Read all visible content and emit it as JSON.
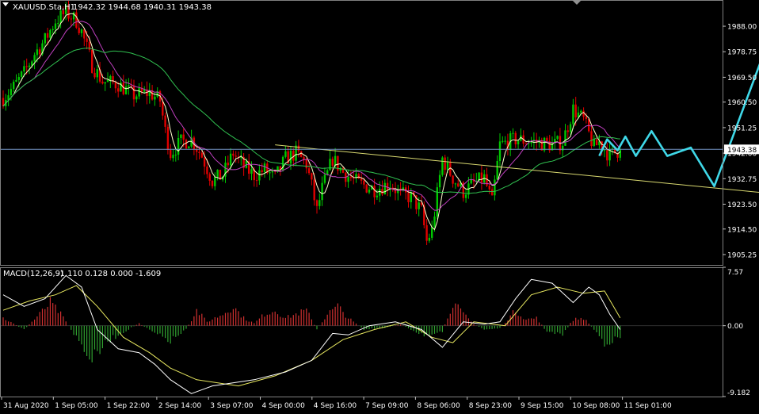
{
  "header": {
    "symbol_title": "XAUUSD.Sta,H1",
    "ohlc": "1942.32 1944.68 1940.31 1943.38"
  },
  "macd": {
    "title": "MACD(12,26,9)",
    "values": "-1.110 0.128 0.000 -1.609"
  },
  "colors": {
    "background": "#000000",
    "bull": "#00C800",
    "bear": "#E00000",
    "ma_fast": "#FFFFCC",
    "ma_mid": "#C040C0",
    "ma_slow": "#30C050",
    "trendline": "#D8D870",
    "forecast": "#3FD8E8",
    "price_line": "#7090C0",
    "macd_main": "#FFFFFF",
    "macd_signal": "#E8E860",
    "macd_hist_pos": "#D03030",
    "macd_hist_neg": "#30A030"
  },
  "chart_data": [
    {
      "type": "candlestick",
      "title": "XAUUSD.Sta,H1",
      "timeframe": "H1",
      "ylim": [
        1901.5,
        1997.5
      ],
      "y_ticks": [
        "1988.00",
        "1978.75",
        "1969.50",
        "1960.50",
        "1951.25",
        "1942.00",
        "1932.75",
        "1923.50",
        "1914.50",
        "1905.25"
      ],
      "current_price": "1943.38",
      "x_tick_labels": [
        "31 Aug 2020",
        "1 Sep 05:00",
        "1 Sep 22:00",
        "2 Sep 14:00",
        "3 Sep 07:00",
        "4 Sep 00:00",
        "4 Sep 16:00",
        "7 Sep 09:00",
        "8 Sep 06:00",
        "8 Sep 23:00",
        "9 Sep 15:00",
        "10 Sep 08:00",
        "11 Sep 01:00"
      ],
      "price_path": [
        [
          0,
          1962
        ],
        [
          4,
          1966
        ],
        [
          8,
          1971
        ],
        [
          12,
          1978
        ],
        [
          16,
          1983
        ],
        [
          20,
          1990
        ],
        [
          24,
          1993
        ],
        [
          28,
          1990
        ],
        [
          30,
          1986
        ],
        [
          34,
          1974
        ],
        [
          38,
          1968
        ],
        [
          44,
          1967
        ],
        [
          50,
          1963
        ],
        [
          56,
          1964
        ],
        [
          60,
          1961
        ],
        [
          62,
          1950
        ],
        [
          64,
          1942
        ],
        [
          68,
          1946
        ],
        [
          72,
          1947
        ],
        [
          76,
          1941
        ],
        [
          80,
          1932
        ],
        [
          84,
          1934
        ],
        [
          88,
          1942
        ],
        [
          92,
          1937
        ],
        [
          96,
          1934
        ],
        [
          100,
          1936
        ],
        [
          104,
          1933
        ],
        [
          108,
          1940
        ],
        [
          112,
          1942
        ],
        [
          116,
          1938
        ],
        [
          118,
          1930
        ],
        [
          120,
          1921
        ],
        [
          122,
          1929
        ],
        [
          126,
          1940
        ],
        [
          130,
          1935
        ],
        [
          136,
          1931
        ],
        [
          142,
          1929
        ],
        [
          148,
          1931
        ],
        [
          152,
          1927
        ],
        [
          156,
          1926
        ],
        [
          160,
          1921
        ],
        [
          162,
          1910
        ],
        [
          164,
          1914
        ],
        [
          168,
          1940
        ],
        [
          172,
          1933
        ],
        [
          176,
          1928
        ],
        [
          180,
          1931
        ],
        [
          184,
          1933
        ],
        [
          187,
          1924
        ],
        [
          190,
          1945
        ],
        [
          196,
          1947
        ],
        [
          204,
          1946
        ],
        [
          210,
          1945
        ],
        [
          214,
          1946
        ],
        [
          218,
          1958
        ],
        [
          222,
          1954
        ],
        [
          226,
          1944
        ],
        [
          228,
          1946
        ],
        [
          232,
          1941
        ],
        [
          236,
          1943.4
        ]
      ],
      "moving_averages": [
        "fast",
        "medium",
        "slow"
      ],
      "trendline": {
        "from": [
          104,
          1945
        ],
        "to": [
          330,
          1924
        ]
      },
      "forecast_path": [
        [
          228,
          1941
        ],
        [
          231,
          1947
        ],
        [
          235,
          1943
        ],
        [
          238,
          1948
        ],
        [
          242,
          1941
        ],
        [
          248,
          1950
        ],
        [
          254,
          1941
        ],
        [
          263,
          1944
        ],
        [
          272,
          1930
        ],
        [
          294,
          1986
        ]
      ]
    },
    {
      "type": "macd",
      "title": "MACD(12,26,9)",
      "ylim": [
        -9.182,
        7.57
      ],
      "y_ticks": [
        "7.57",
        "0.00",
        "-9.182"
      ],
      "main_path": [
        [
          0,
          4.0
        ],
        [
          8,
          2.5
        ],
        [
          16,
          3.5
        ],
        [
          24,
          6.5
        ],
        [
          30,
          5.0
        ],
        [
          36,
          -0.5
        ],
        [
          44,
          -3.0
        ],
        [
          52,
          -3.5
        ],
        [
          58,
          -5.0
        ],
        [
          64,
          -7.0
        ],
        [
          72,
          -8.8
        ],
        [
          80,
          -7.8
        ],
        [
          96,
          -7.0
        ],
        [
          108,
          -6.0
        ],
        [
          118,
          -4.5
        ],
        [
          126,
          -1.0
        ],
        [
          132,
          -1.2
        ],
        [
          140,
          0.0
        ],
        [
          150,
          0.5
        ],
        [
          160,
          -0.5
        ],
        [
          168,
          -2.8
        ],
        [
          176,
          0.5
        ],
        [
          184,
          0.2
        ],
        [
          190,
          0.5
        ],
        [
          196,
          3.5
        ],
        [
          202,
          6.0
        ],
        [
          210,
          5.5
        ],
        [
          218,
          3.0
        ],
        [
          224,
          5.0
        ],
        [
          228,
          4.0
        ],
        [
          232,
          1.5
        ],
        [
          236,
          -0.5
        ]
      ],
      "signal_path": [
        [
          0,
          2.0
        ],
        [
          10,
          3.2
        ],
        [
          20,
          4.0
        ],
        [
          28,
          5.2
        ],
        [
          36,
          2.5
        ],
        [
          46,
          -1.5
        ],
        [
          56,
          -3.5
        ],
        [
          64,
          -5.5
        ],
        [
          74,
          -7.0
        ],
        [
          90,
          -7.8
        ],
        [
          104,
          -6.5
        ],
        [
          118,
          -4.5
        ],
        [
          130,
          -1.8
        ],
        [
          142,
          -0.5
        ],
        [
          154,
          0.5
        ],
        [
          164,
          -1.5
        ],
        [
          172,
          -2.2
        ],
        [
          180,
          0.5
        ],
        [
          192,
          0.0
        ],
        [
          202,
          4.0
        ],
        [
          212,
          5.0
        ],
        [
          222,
          4.2
        ],
        [
          230,
          4.5
        ],
        [
          236,
          1.0
        ]
      ],
      "histogram_path": [
        [
          0,
          1.0
        ],
        [
          8,
          -0.5
        ],
        [
          14,
          1.5
        ],
        [
          18,
          3.0
        ],
        [
          22,
          1.5
        ],
        [
          28,
          -1.5
        ],
        [
          34,
          -4.5
        ],
        [
          40,
          -2.0
        ],
        [
          46,
          -0.8
        ],
        [
          52,
          0.3
        ],
        [
          58,
          -1.0
        ],
        [
          64,
          -2.0
        ],
        [
          70,
          -0.5
        ],
        [
          74,
          2.0
        ],
        [
          78,
          0.5
        ],
        [
          84,
          1.5
        ],
        [
          88,
          2.5
        ],
        [
          92,
          1.0
        ],
        [
          96,
          0.3
        ],
        [
          100,
          1.5
        ],
        [
          104,
          2.0
        ],
        [
          108,
          1.0
        ],
        [
          112,
          1.5
        ],
        [
          116,
          2.0
        ],
        [
          120,
          -0.5
        ],
        [
          124,
          1.5
        ],
        [
          128,
          2.5
        ],
        [
          132,
          1.0
        ],
        [
          138,
          -0.5
        ],
        [
          146,
          -0.3
        ],
        [
          152,
          0.2
        ],
        [
          158,
          -0.8
        ],
        [
          164,
          -1.5
        ],
        [
          168,
          -0.8
        ],
        [
          172,
          3.0
        ],
        [
          176,
          1.5
        ],
        [
          180,
          0.2
        ],
        [
          184,
          -0.5
        ],
        [
          190,
          -0.3
        ],
        [
          196,
          2.0
        ],
        [
          200,
          0.8
        ],
        [
          204,
          1.0
        ],
        [
          208,
          -0.8
        ],
        [
          214,
          -1.2
        ],
        [
          218,
          0.8
        ],
        [
          222,
          1.0
        ],
        [
          226,
          -0.5
        ],
        [
          230,
          -2.2
        ],
        [
          236,
          -1.6
        ]
      ]
    }
  ]
}
